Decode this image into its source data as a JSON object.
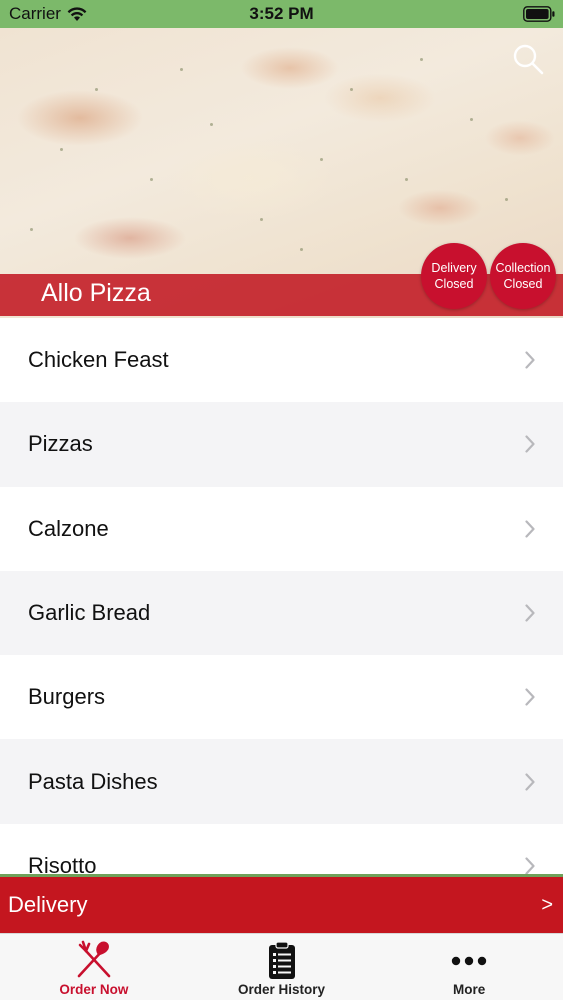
{
  "status_bar": {
    "carrier": "Carrier",
    "time": "3:52 PM"
  },
  "header": {
    "store_name": "Allo Pizza",
    "search_icon": "search-icon",
    "delivery_status": {
      "line1": "Delivery",
      "line2": "Closed"
    },
    "collection_status": {
      "line1": "Collection",
      "line2": "Closed"
    }
  },
  "menu": {
    "items": [
      {
        "label": "Chicken Feast"
      },
      {
        "label": "Pizzas"
      },
      {
        "label": "Calzone"
      },
      {
        "label": "Garlic Bread"
      },
      {
        "label": "Burgers"
      },
      {
        "label": "Pasta Dishes"
      },
      {
        "label": "Risotto"
      }
    ]
  },
  "order_mode": {
    "label": "Delivery",
    "arrow": ">"
  },
  "tabs": [
    {
      "label": "Order Now",
      "icon": "fork-knife-icon",
      "active": true
    },
    {
      "label": "Order History",
      "icon": "clipboard-list-icon",
      "active": false
    },
    {
      "label": "More",
      "icon": "more-dots-icon",
      "active": false
    }
  ],
  "colors": {
    "brand_red": "#c8102e",
    "status_bar_green": "#7cb96a"
  }
}
